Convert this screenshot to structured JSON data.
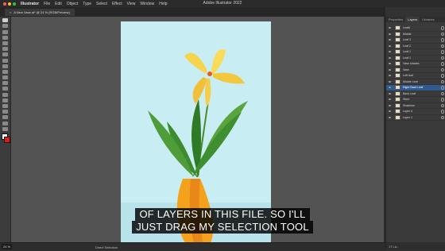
{
  "menubar": {
    "app": "Illustrator",
    "items": [
      "File",
      "Edit",
      "Object",
      "Type",
      "Select",
      "Effect",
      "View",
      "Window",
      "Help"
    ],
    "title": "Adobe Illustrator 2022"
  },
  "document_tab": {
    "label": "A New Vase.ai* @ 24 % (RGB/Preview)"
  },
  "status": {
    "zoom": "24 %",
    "tool": "Direct Selection"
  },
  "panel": {
    "tabs": [
      "Properties",
      "Layers",
      "Libraries"
    ],
    "active_tab": "Layers",
    "layers": [
      {
        "name": "Leaf6",
        "selected": false
      },
      {
        "name": "Middle",
        "selected": false
      },
      {
        "name": "Leaf 3",
        "selected": false
      },
      {
        "name": "Leaf 2",
        "selected": false
      },
      {
        "name": "Leaf 1",
        "selected": false
      },
      {
        "name": "Leaf 1",
        "selected": false
      },
      {
        "name": "Vase shades",
        "selected": false
      },
      {
        "name": "Vase",
        "selected": false
      },
      {
        "name": "Left leaf",
        "selected": false
      },
      {
        "name": "Middle Leaf",
        "selected": false
      },
      {
        "name": "Right Back Leaf",
        "selected": true
      },
      {
        "name": "Back Leaf",
        "selected": false
      },
      {
        "name": "Stem",
        "selected": false
      },
      {
        "name": "Shadows",
        "selected": false
      },
      {
        "name": "Layer 4",
        "selected": false
      },
      {
        "name": "Layer 1",
        "selected": false
      }
    ],
    "footer": "17 La..."
  },
  "caption": {
    "line1": "OF LAYERS IN THIS FILE. SO I'LL",
    "line2": "JUST DRAG MY SELECTION TOOL"
  },
  "colors": {
    "accent": "#2f5a8e",
    "artboard": "#c8eef4",
    "stroke": "#d81b1b"
  }
}
